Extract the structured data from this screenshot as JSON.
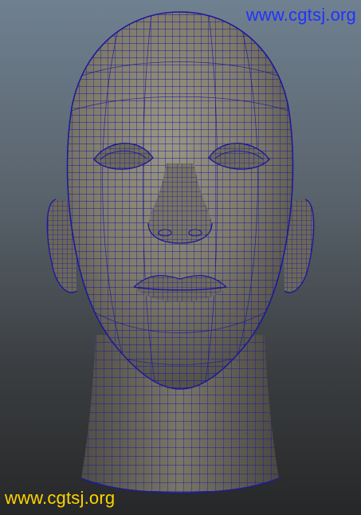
{
  "viewport": {
    "background_top": "#6f8090",
    "background_bottom": "#262728",
    "mesh_color": "#1c1a9a",
    "surface_color": "#8a8676"
  },
  "watermarks": {
    "top_right": "www.cgtsj.org",
    "bottom_left": "www.cgtsj.org",
    "top_right_color": "#1f33ff",
    "bottom_left_color": "#ffd400"
  },
  "model": {
    "icon": "wireframe-head-icon"
  }
}
